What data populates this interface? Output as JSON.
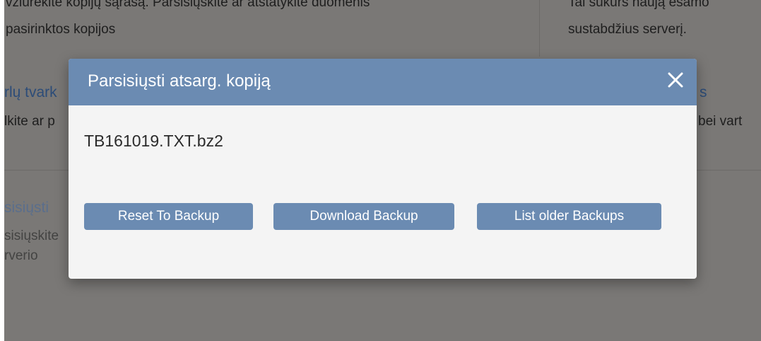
{
  "background": {
    "top_left_line1": "vziūrėkite kopijų sąrašą. Parsisiųskite ar atstatykite duomenis",
    "top_left_line2": "pasirinktos kopijos",
    "top_right_line1": "Tai sukurs naują esamo",
    "top_right_line2": "sustabdžius serverį.",
    "mid_left_title": "rlų tvark",
    "mid_left_desc": "lkite ar p",
    "mid_right_title": "s",
    "mid_right_desc": "bei vart",
    "bottom_left_title": "sisiųsti",
    "bottom_left_desc1": "sisiųskite",
    "bottom_left_desc2": "rverio"
  },
  "modal": {
    "title": "Parsisiųsti atsarg. kopiją",
    "close_icon": "close-icon",
    "filename": "TB161019.TXT.bz2",
    "buttons": {
      "reset": "Reset To Backup",
      "download": "Download Backup",
      "list": "List older Backups"
    }
  },
  "colors": {
    "accent": "#6b8bb2",
    "overlay": "#7a7876"
  }
}
